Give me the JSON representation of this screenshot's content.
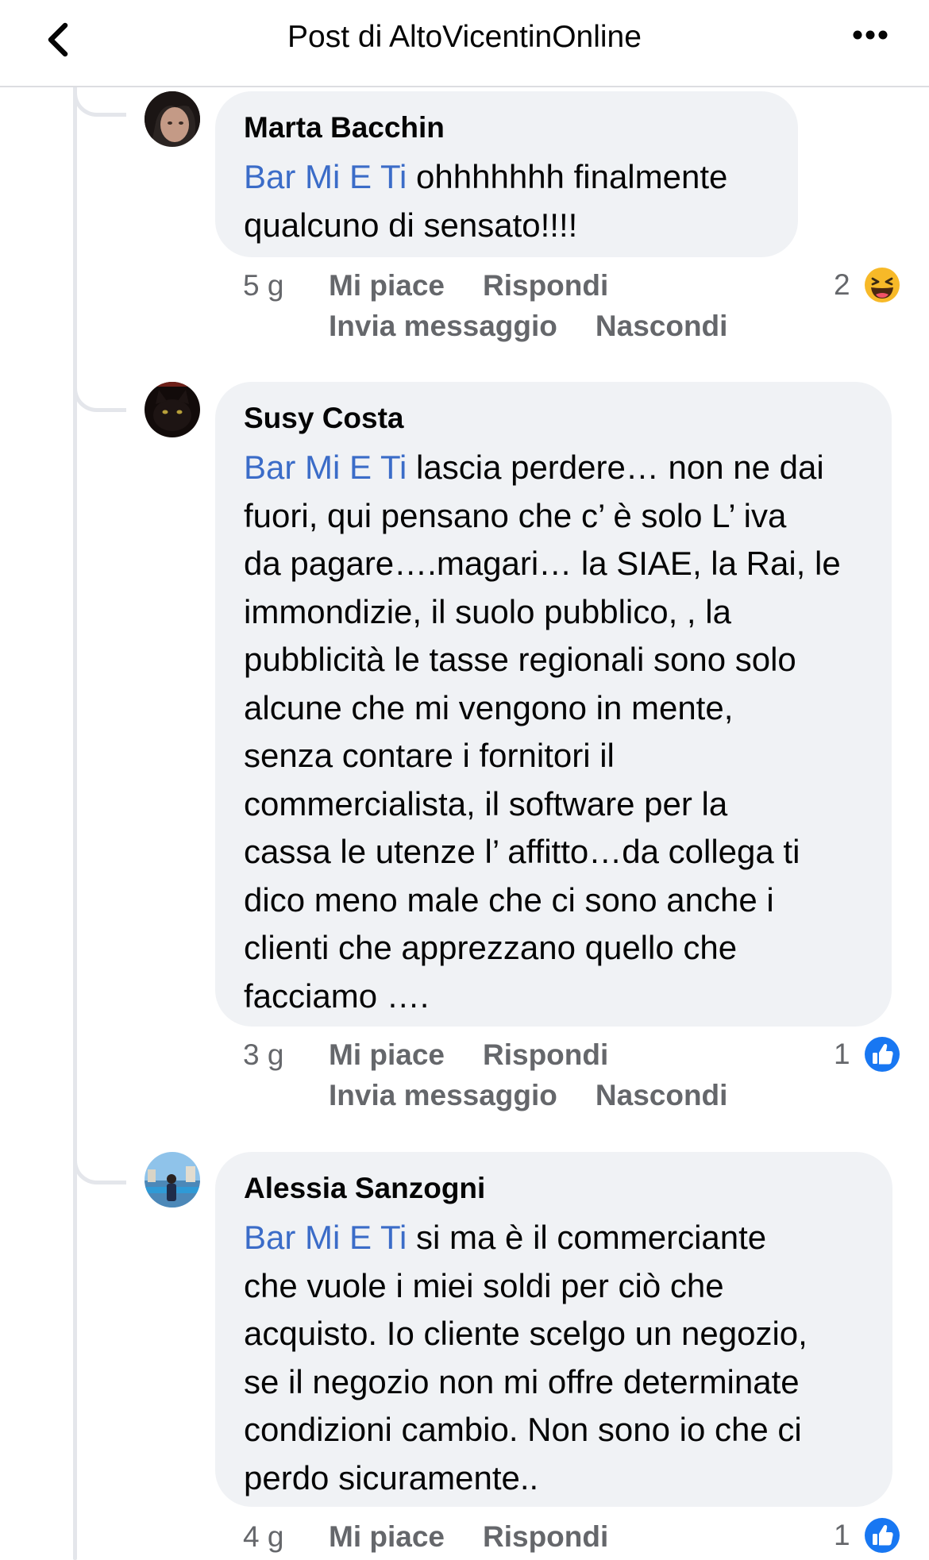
{
  "header": {
    "title": "Post di AltoVicentinOnline",
    "back_icon": "chevron-left-icon",
    "more_icon": "more-dots-icon"
  },
  "comments": [
    {
      "author": "Marta Bacchin",
      "mention": "Bar Mi E Ti",
      "text": " ohhhhhhh finalmente\nqualcuno di sensato!!!!",
      "time": "5 g",
      "like_label": "Mi piace",
      "reply_label": "Rispondi",
      "message_label": "Invia messaggio",
      "hide_label": "Nascondi",
      "reaction_count": "2",
      "reaction_icon": "haha-emoji-icon"
    },
    {
      "author": "Susy Costa",
      "mention": "Bar Mi E Ti",
      "text": " lascia perdere… non ne dai\nfuori, qui pensano che c’ è solo L’ iva\nda pagare….magari… la SIAE, la Rai, le\nimmondizie, il suolo pubblico, , la\npubblicità le tasse regionali sono solo\nalcune che mi vengono in mente,\nsenza contare i fornitori il\ncommercialista, il software per la\ncassa le utenze l’ affitto…da collega ti\ndico meno male che ci sono anche i\nclienti che apprezzano quello che\nfacciamo ….",
      "time": "3 g",
      "like_label": "Mi piace",
      "reply_label": "Rispondi",
      "message_label": "Invia messaggio",
      "hide_label": "Nascondi",
      "reaction_count": "1",
      "reaction_icon": "like-thumb-icon"
    },
    {
      "author": "Alessia Sanzogni",
      "mention": "Bar Mi E Ti",
      "text": " si ma è il commerciante\nche vuole i miei soldi per ciò che\nacquisto. Io cliente scelgo un negozio,\nse il negozio non mi offre determinate\ncondizioni cambio. Non sono io che ci\nperdo sicuramente..",
      "time": "4 g",
      "like_label": "Mi piace",
      "reply_label": "Rispondi",
      "reaction_count": "1",
      "reaction_icon": "like-thumb-icon"
    }
  ],
  "colors": {
    "mention": "#3b6cc8",
    "bubble": "#f0f2f5",
    "secondary_text": "#65676b",
    "like_blue": "#1877f2"
  }
}
